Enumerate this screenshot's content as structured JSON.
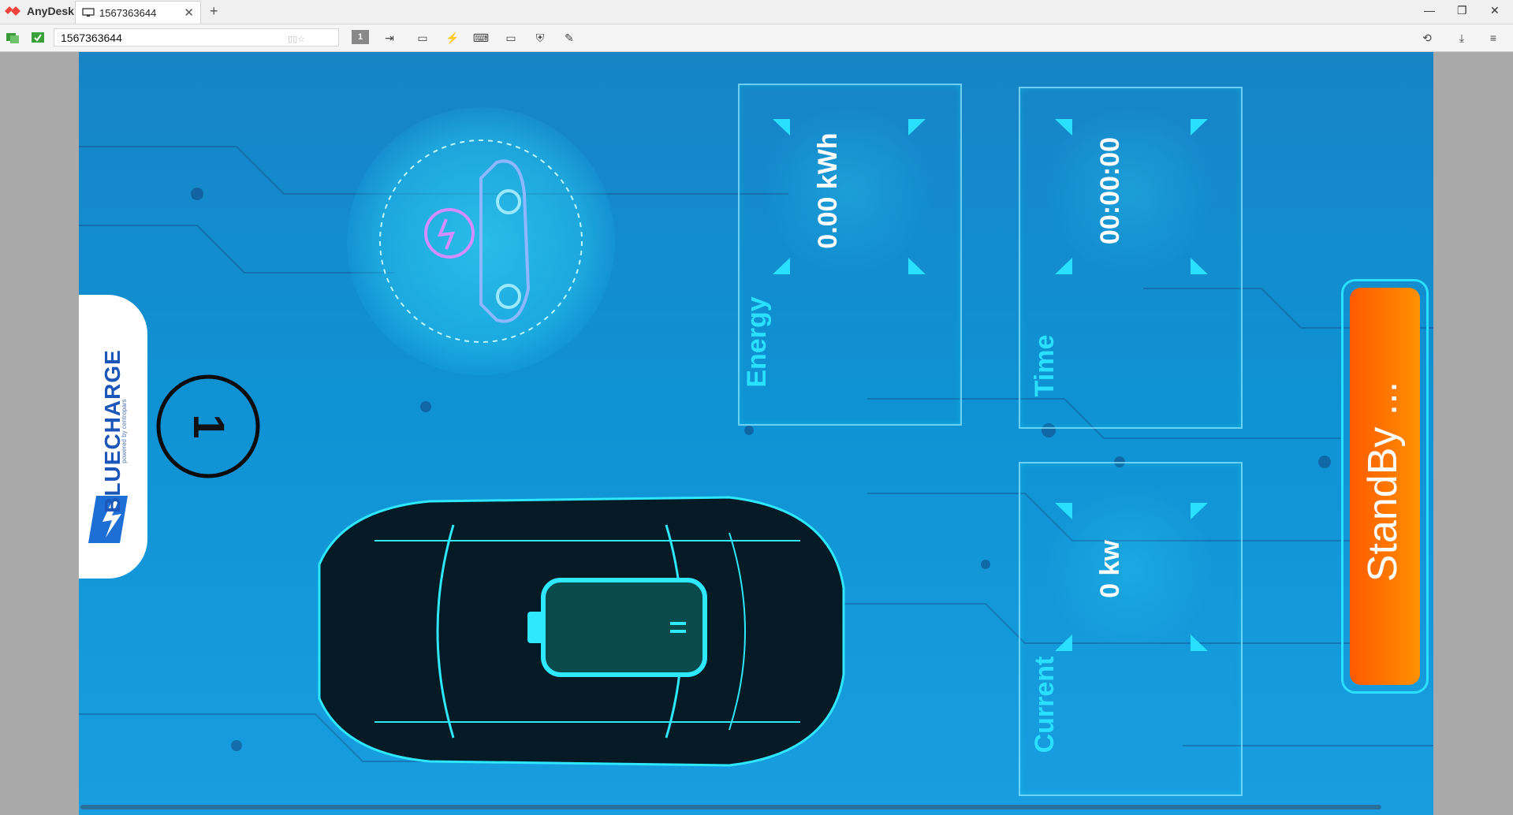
{
  "app": {
    "name": "AnyDesk",
    "tab_title": "1567363644",
    "address": "1567363644"
  },
  "toolbar": {
    "monitor_badge": "1"
  },
  "remote": {
    "logo_text": "BLUECHARGE",
    "logo_sub": "powered by centropars",
    "station_number": "1",
    "energy": {
      "label": "Energy",
      "value": "0.00 kWh"
    },
    "time": {
      "label": "Time",
      "value": "00:00:00"
    },
    "current": {
      "label": "Current",
      "value": "0 kw"
    },
    "status_button": "StandBy ..."
  },
  "colors": {
    "bg": "#0f92d3",
    "accent": "#29e0ff",
    "orange": "#ff7a00"
  }
}
